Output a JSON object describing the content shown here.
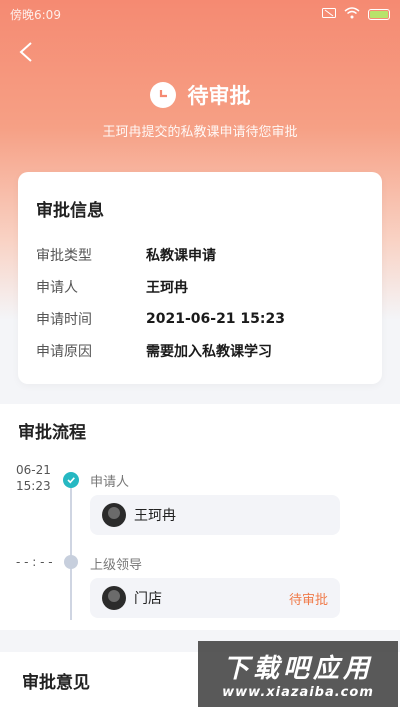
{
  "status_bar": {
    "time": "傍晚6:09"
  },
  "header": {
    "status_title": "待审批",
    "subtitle": "王珂冉提交的私教课申请待您审批"
  },
  "info_card": {
    "title": "审批信息",
    "rows": [
      {
        "label": "审批类型",
        "value": "私教课申请"
      },
      {
        "label": "申请人",
        "value": "王珂冉"
      },
      {
        "label": "申请时间",
        "value": "2021-06-21 15:23"
      },
      {
        "label": "申请原因",
        "value": "需要加入私教课学习"
      }
    ]
  },
  "flow": {
    "title": "审批流程",
    "steps": [
      {
        "date": "06-21",
        "time": "15:23",
        "role": "申请人",
        "name": "王珂冉",
        "state": "",
        "status": "done"
      },
      {
        "date": "- - : - -",
        "time": "",
        "role": "上级领导",
        "name": "门店",
        "state": "待审批",
        "status": "pending"
      }
    ]
  },
  "opinion": {
    "title": "审批意见"
  },
  "watermark": {
    "main": "下载吧应用",
    "url": "www.xiazaiba.com"
  },
  "colors": {
    "accent": "#f58a72",
    "done": "#26b8c2",
    "pending_text": "#f07b4a"
  }
}
